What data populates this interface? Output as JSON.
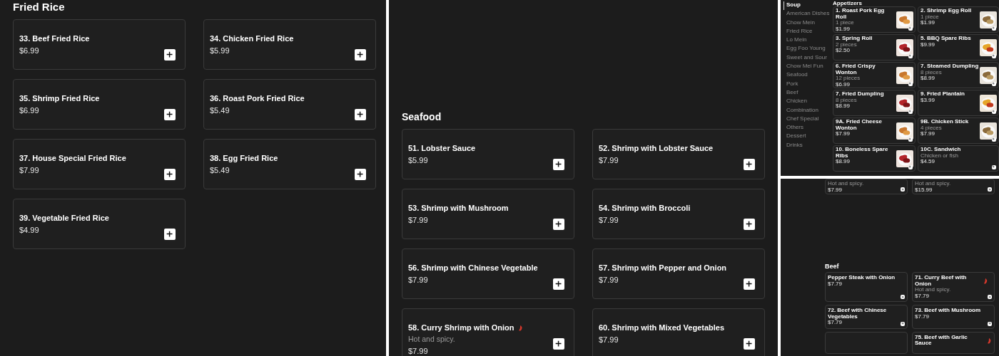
{
  "panels": [
    {
      "kind": "wide-grid",
      "sections": [
        {
          "heading": "Fried Rice",
          "items": [
            {
              "title": "33. Beef Fried Rice",
              "price": "$6.99"
            },
            {
              "title": "34. Chicken Fried Rice",
              "price": "$5.99"
            },
            {
              "title": "35. Shrimp Fried Rice",
              "price": "$6.99"
            },
            {
              "title": "36. Roast Pork Fried Rice",
              "price": "$5.49"
            },
            {
              "title": "37. House Special Fried Rice",
              "price": "$7.99"
            },
            {
              "title": "38. Egg Fried Rice",
              "price": "$5.49"
            },
            {
              "title": "39. Vegetable Fried Rice",
              "price": "$4.99"
            }
          ]
        }
      ]
    },
    {
      "kind": "wide-grid",
      "sections": [
        {
          "heading": "Seafood",
          "items": [
            {
              "title": "51. Lobster Sauce",
              "price": "$5.99"
            },
            {
              "title": "52. Shrimp with Lobster Sauce",
              "price": "$7.99"
            },
            {
              "title": "53. Shrimp with Mushroom",
              "price": "$7.99"
            },
            {
              "title": "54. Shrimp with Broccoli",
              "price": "$7.99"
            },
            {
              "title": "56. Shrimp with Chinese Vegetable",
              "price": "$7.99"
            },
            {
              "title": "57. Shrimp with Pepper and Onion",
              "price": "$7.99"
            },
            {
              "title": "58. Curry Shrimp with Onion",
              "spicy": true,
              "description": "Hot and spicy.",
              "price": "$7.99"
            },
            {
              "title": "60. Shrimp with Mixed Vegetables",
              "price": "$7.99"
            }
          ]
        }
      ]
    },
    {
      "kind": "sidebar-grid",
      "sidebar": [
        {
          "label": "Soup",
          "selected": true
        },
        {
          "label": "American Dishes",
          "selected": false
        },
        {
          "label": "Chow Mein",
          "selected": false
        },
        {
          "label": "Fried Rice",
          "selected": false
        },
        {
          "label": "Lo Mein",
          "selected": false
        },
        {
          "label": "Egg Foo Young",
          "selected": false
        },
        {
          "label": "Sweet and Sour",
          "selected": false
        },
        {
          "label": "Chow Mei Fun",
          "selected": false
        },
        {
          "label": "Seafood",
          "selected": false
        },
        {
          "label": "Pork",
          "selected": false
        },
        {
          "label": "Beef",
          "selected": false
        },
        {
          "label": "Chicken",
          "selected": false
        },
        {
          "label": "Combination",
          "selected": false
        },
        {
          "label": "Chef Special",
          "selected": false
        },
        {
          "label": "Others",
          "selected": false
        },
        {
          "label": "Dessert",
          "selected": false
        },
        {
          "label": "Drinks",
          "selected": false
        }
      ],
      "sections": [
        {
          "heading": "Appetizers",
          "items": [
            {
              "title": "1. Roast Pork Egg Roll",
              "description": "1 piece",
              "price": "$1.99",
              "photo": true
            },
            {
              "title": "2. Shrimp Egg Roll",
              "description": "1 piece",
              "price": "$1.99",
              "photo": true
            },
            {
              "title": "3. Spring Roll",
              "description": "2 pieces",
              "price": "$2.50",
              "photo": true
            },
            {
              "title": "5. BBQ Spare Ribs",
              "price": "$9.99",
              "photo": true
            },
            {
              "title": "6. Fried Crispy Wonton",
              "description": "12 pieces",
              "price": "$6.99",
              "photo": true
            },
            {
              "title": "7. Steamed Dumpling",
              "description": "8 pieces",
              "price": "$8.99",
              "photo": true
            },
            {
              "title": "7. Fried Dumpling",
              "description": "8 pieces",
              "price": "$8.99",
              "photo": true
            },
            {
              "title": "9. Fried Plantain",
              "price": "$3.99",
              "photo": true
            },
            {
              "title": "9A. Fried Cheese Wonton",
              "price": "$7.99",
              "photo": true
            },
            {
              "title": "9B. Chicken Stick",
              "description": "4 pieces",
              "price": "$7.99",
              "photo": true
            },
            {
              "title": "10. Boneless Spare Ribs",
              "price": "$8.99",
              "photo": true
            },
            {
              "title": "10C. Sandwich",
              "description": "Chicken or fish",
              "price": "$4.59",
              "photo": false
            }
          ]
        }
      ]
    },
    {
      "kind": "compact-grid",
      "sections": [
        {
          "items": [
            {
              "description": "Hot and spicy.",
              "price": "$7.99"
            },
            {
              "description": "Hot and spicy.",
              "price": "$15.99"
            }
          ]
        },
        {
          "heading": "Beef",
          "items": [
            {
              "title": "Pepper Steak with Onion",
              "price": "$7.79"
            },
            {
              "title": "71. Curry Beef with Onion",
              "spicy": true,
              "description": "Hot and spicy.",
              "price": "$7.79"
            },
            {
              "title": "72. Beef with Chinese Vegetables",
              "price": "$7.79"
            },
            {
              "title": "73. Beef with Mushroom",
              "price": "$7.79"
            },
            {
              "add_button": false
            },
            {
              "title": "75. Beef with Garlic Sauce",
              "spicy": true
            }
          ]
        }
      ]
    }
  ]
}
